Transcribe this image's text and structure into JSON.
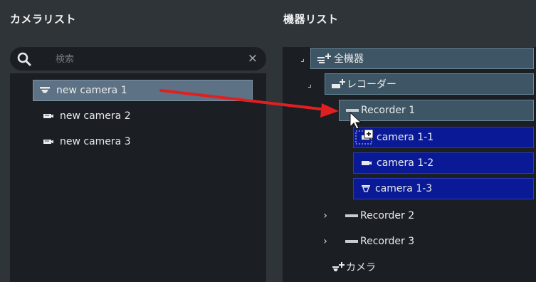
{
  "left_panel": {
    "title": "カメラリスト"
  },
  "search": {
    "placeholder": "検索",
    "clear": "×"
  },
  "cameras": [
    {
      "label": "new camera 1"
    },
    {
      "label": "new camera 2"
    },
    {
      "label": "new camera 3"
    }
  ],
  "right_panel": {
    "title": "機器リスト"
  },
  "tree": {
    "root": "全機器",
    "recorders_group": "レコーダー",
    "recorder1": "Recorder 1",
    "recorder1_cameras": [
      "camera 1-1",
      "camera 1-2",
      "camera 1-3"
    ],
    "recorder2": "Recorder 2",
    "recorder3": "Recorder 3",
    "cameras_group": "カメラ"
  },
  "colors": {
    "background": "#2f3439",
    "list_background": "#1b1e22",
    "selected_left": "#5d7284",
    "tree_highlight": "#3d5564",
    "tree_selected": "#0a1a96",
    "drag_arrow": "#e02020"
  }
}
